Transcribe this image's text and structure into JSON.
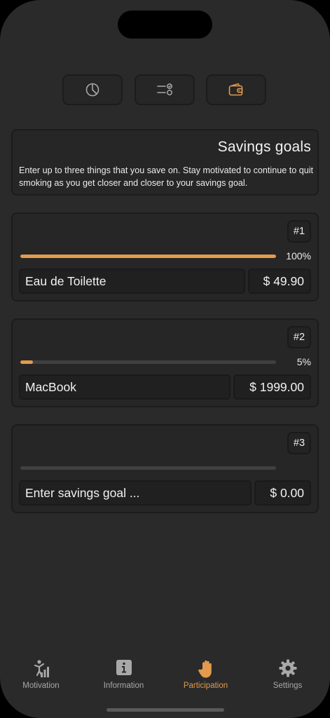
{
  "segments": [
    {
      "icon": "pie-chart-icon",
      "active": false
    },
    {
      "icon": "checklist-icon",
      "active": false
    },
    {
      "icon": "wallet-icon",
      "active": true
    }
  ],
  "intro": {
    "title": "Savings goals",
    "text": "Enter up to three things that you save on. Stay motivated to continue to quit smoking as you get closer and closer to your savings goal."
  },
  "goals": [
    {
      "badge": "#1",
      "progress": 100,
      "progress_label": "100%",
      "name": "Eau de Toilette",
      "price": "$ 49.90"
    },
    {
      "badge": "#2",
      "progress": 5,
      "progress_label": "5%",
      "name": "MacBook",
      "price": "$ 1999.00"
    },
    {
      "badge": "#3",
      "progress": 0,
      "progress_label": "",
      "name": "Enter savings goal ...",
      "price": "$ 0.00"
    }
  ],
  "tabs": [
    {
      "label": "Motivation",
      "icon": "motivation-chart-icon",
      "active": false
    },
    {
      "label": "Information",
      "icon": "info-icon",
      "active": false
    },
    {
      "label": "Participation",
      "icon": "raised-hand-icon",
      "active": true
    },
    {
      "label": "Settings",
      "icon": "gear-icon",
      "active": false
    }
  ],
  "colors": {
    "accent": "#e39a4c",
    "background": "#2a2a2a",
    "card": "#262626",
    "inactive_icon": "#a8a8a8"
  }
}
